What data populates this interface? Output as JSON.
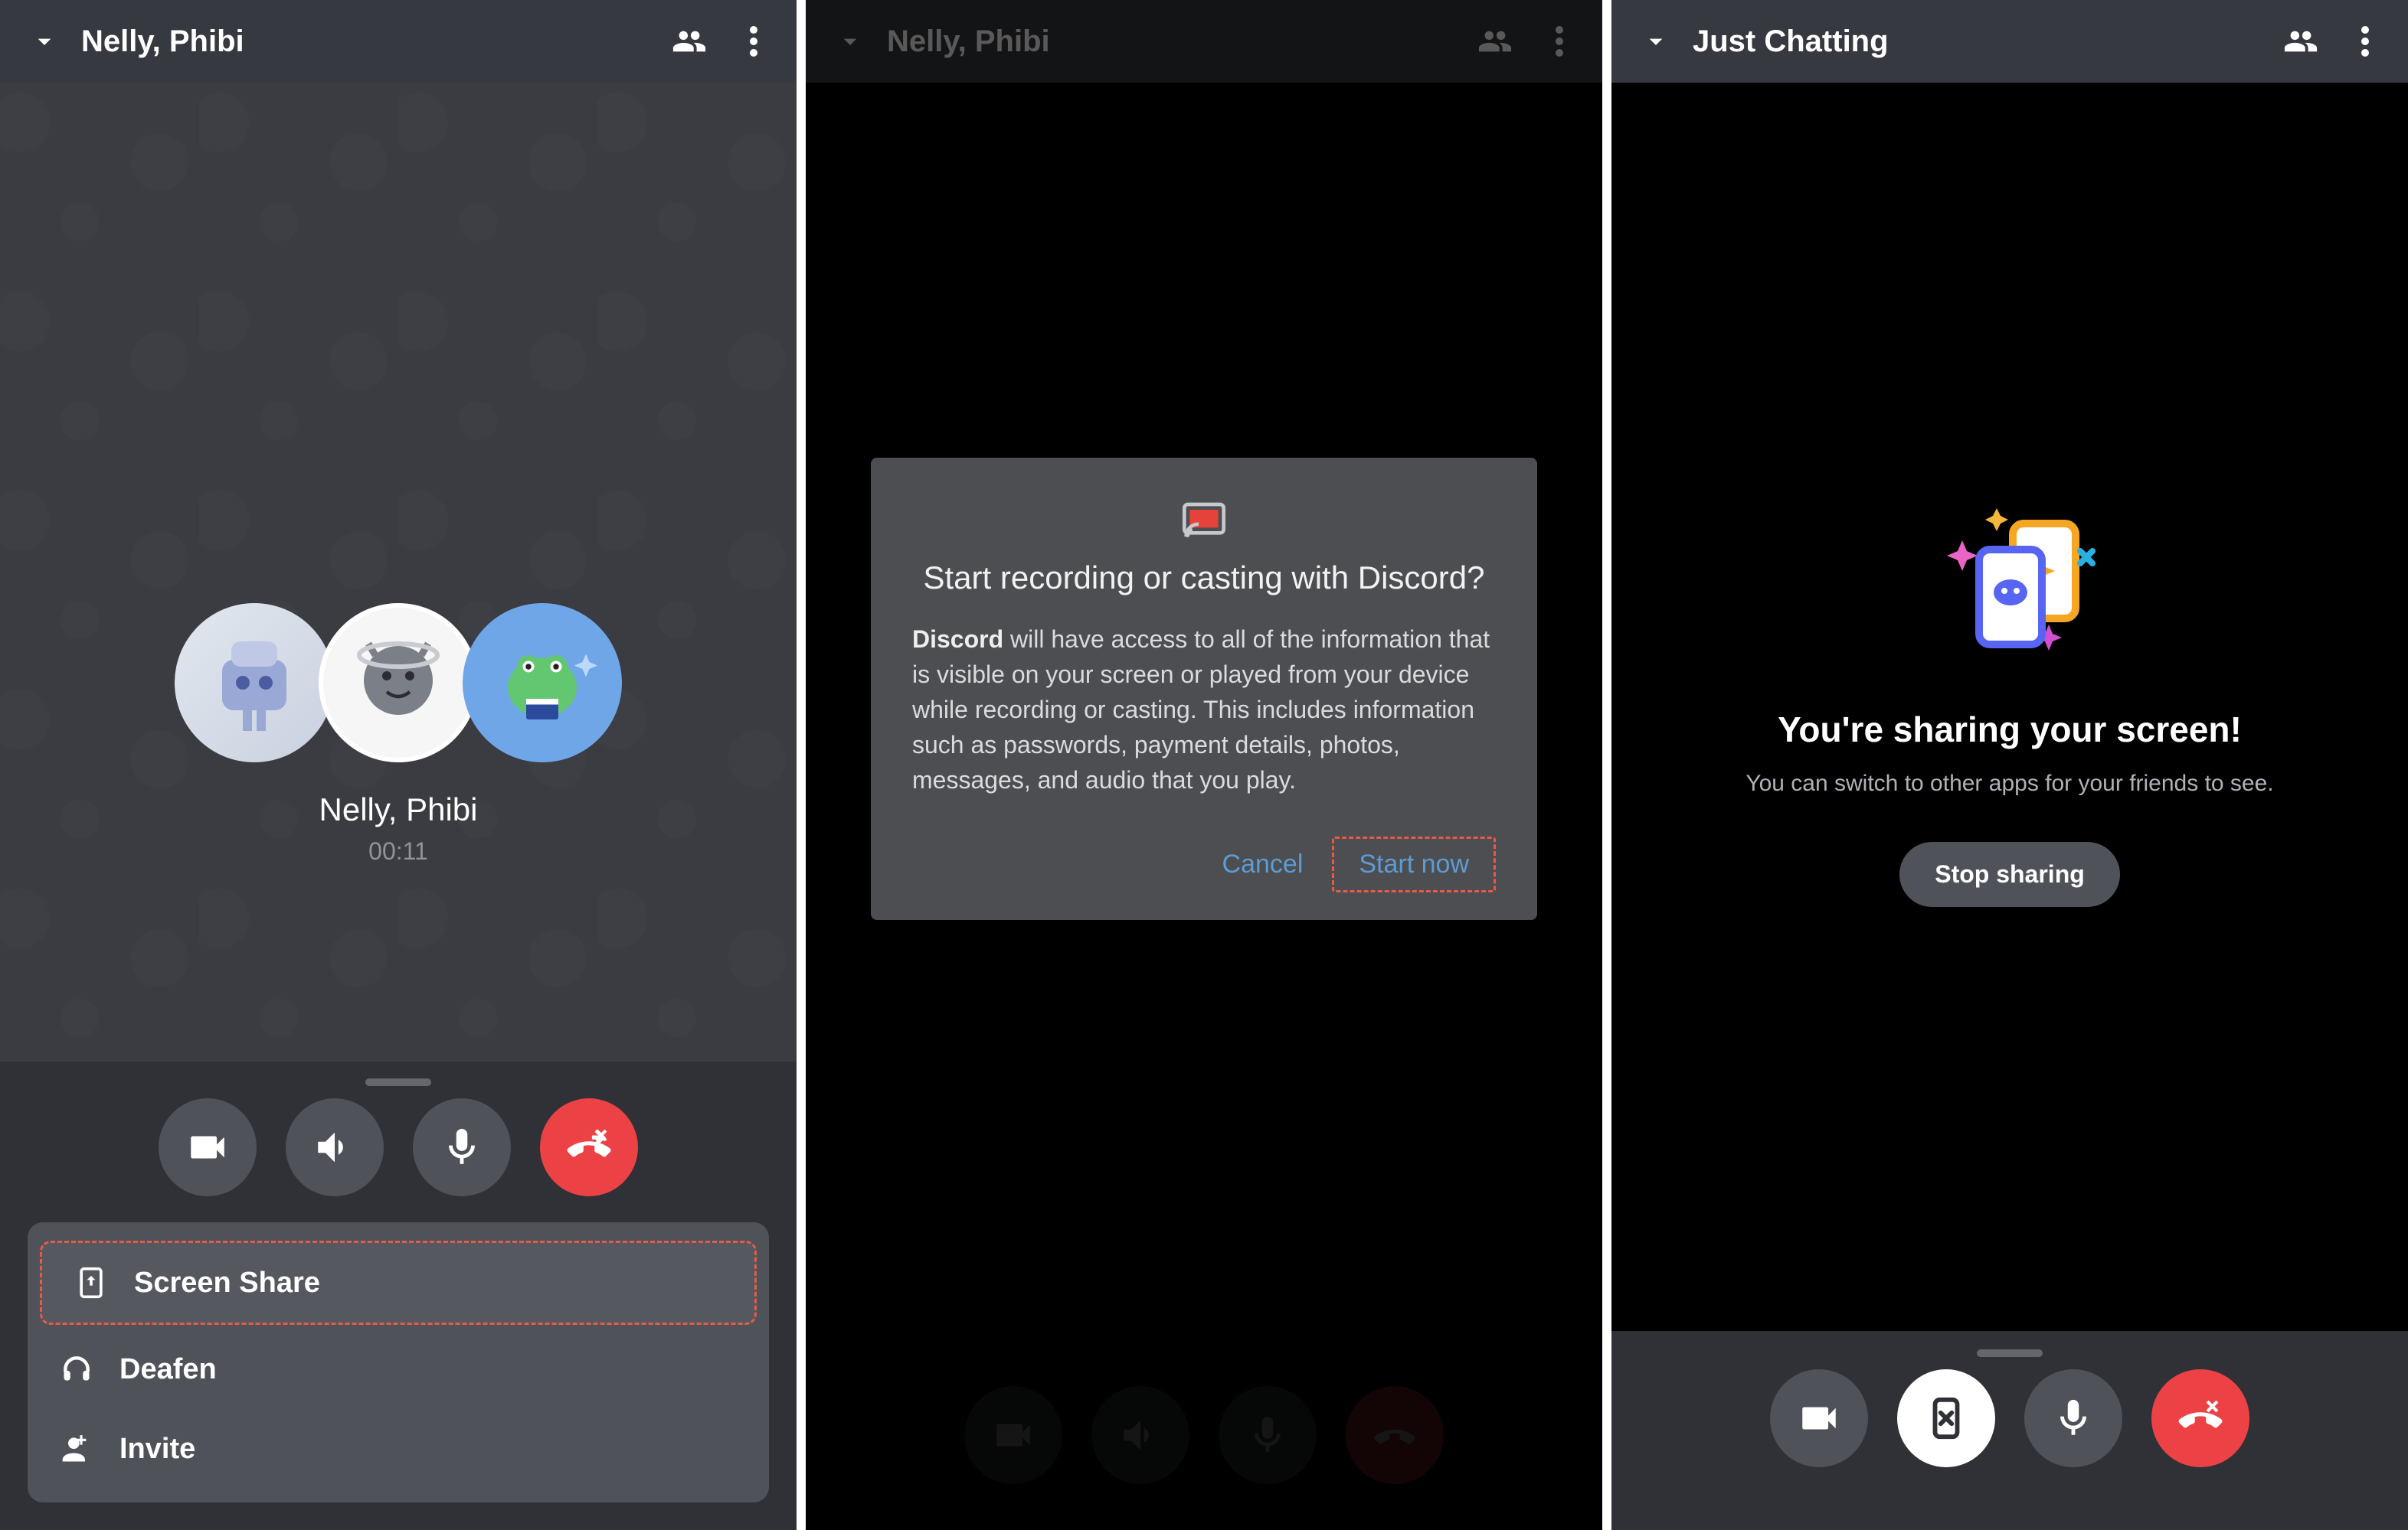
{
  "panel1": {
    "header": {
      "title": "Nelly, Phibi"
    },
    "callInfo": {
      "participants": "Nelly, Phibi",
      "elapsed": "00:11"
    },
    "drawer": {
      "screenShare": "Screen Share",
      "deafen": "Deafen",
      "invite": "Invite"
    }
  },
  "panel2": {
    "header": {
      "title": "Nelly, Phibi"
    },
    "modal": {
      "title": "Start recording or casting with Discord?",
      "boldLead": "Discord",
      "bodyRest": " will have access to all of the information that is visible on your screen or played from your device while recording or casting. This includes information such as passwords, payment details, photos, messages, and audio that you play.",
      "cancel": "Cancel",
      "start": "Start now"
    }
  },
  "panel3": {
    "header": {
      "title": "Just Chatting"
    },
    "share": {
      "title": "You're sharing your screen!",
      "subtitle": "You can switch to other apps for your friends to see.",
      "stop": "Stop sharing"
    }
  }
}
